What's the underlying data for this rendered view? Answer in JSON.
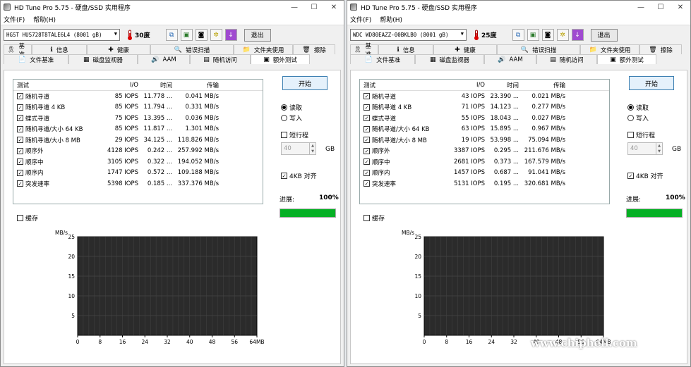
{
  "menu": {
    "file": "文件(F)",
    "help": "帮助(H)"
  },
  "window_buttons": {
    "minimize": "—",
    "maximize": "☐",
    "close": "✕"
  },
  "tabs_row1": [
    {
      "label": "基准",
      "icon": "ribbon-icon"
    },
    {
      "label": "信息",
      "icon": "info-icon"
    },
    {
      "label": "健康",
      "icon": "health-icon"
    },
    {
      "label": "错误扫描",
      "icon": "magnifier-icon"
    },
    {
      "label": "文件夹使用",
      "icon": "folder-icon"
    },
    {
      "label": "擦除",
      "icon": "trash-icon"
    }
  ],
  "tabs_row2": [
    {
      "label": "文件基准",
      "icon": "file-benchmark-icon"
    },
    {
      "label": "磁盘监视器",
      "icon": "disk-monitor-icon"
    },
    {
      "label": "AAM",
      "icon": "speaker-icon"
    },
    {
      "label": "随机访问",
      "icon": "random-access-icon"
    },
    {
      "label": "额外测试",
      "icon": "extra-tests-icon",
      "active": true
    }
  ],
  "table_headers": {
    "test": "测试",
    "io": "I/O",
    "time": "时间",
    "transfer": "传输"
  },
  "controls": {
    "start": "开始",
    "read": "读取",
    "write": "写入",
    "short_stroke": "短行程",
    "stroke_value": "40",
    "gb": "GB",
    "align_4kb": "4KB 对齐",
    "progress_label": "进展:",
    "cache": "缓存"
  },
  "chart_axes": {
    "y_unit": "MB/s",
    "y_ticks": [
      "25",
      "20",
      "15",
      "10",
      "5"
    ],
    "x_ticks": [
      "0",
      "8",
      "16",
      "24",
      "32",
      "40",
      "48",
      "56",
      "64MB"
    ]
  },
  "windows": [
    {
      "title": "HD Tune Pro 5.75 - 硬盘/SSD 实用程序",
      "drive": "HGST HUS728T8TALE6L4 (8001 gB)",
      "temperature": "30度",
      "exit": "退出",
      "progress": "100%",
      "progress_fraction": 1.0,
      "rows": [
        {
          "name": "随机寻道",
          "io": "85 IOPS",
          "time": "11.778 ...",
          "transfer": "0.041 MB/s"
        },
        {
          "name": "随机寻道 4 KB",
          "io": "85 IOPS",
          "time": "11.794 ...",
          "transfer": "0.331 MB/s"
        },
        {
          "name": "蝶式寻道",
          "io": "75 IOPS",
          "time": "13.395 ...",
          "transfer": "0.036 MB/s"
        },
        {
          "name": "随机寻道/大小 64 KB",
          "io": "85 IOPS",
          "time": "11.817 ...",
          "transfer": "1.301 MB/s"
        },
        {
          "name": "随机寻道/大小 8 MB",
          "io": "29 IOPS",
          "time": "34.125 ...",
          "transfer": "118.826 MB/s"
        },
        {
          "name": "顺序外",
          "io": "4128 IOPS",
          "time": "0.242 ...",
          "transfer": "257.992 MB/s"
        },
        {
          "name": "顺序中",
          "io": "3105 IOPS",
          "time": "0.322 ...",
          "transfer": "194.052 MB/s"
        },
        {
          "name": "顺序内",
          "io": "1747 IOPS",
          "time": "0.572 ...",
          "transfer": "109.188 MB/s"
        },
        {
          "name": "突发速率",
          "io": "5398 IOPS",
          "time": "0.185 ...",
          "transfer": "337.376 MB/s"
        }
      ]
    },
    {
      "title": "HD Tune Pro 5.75 - 硬盘/SSD 实用程序",
      "drive": "WDC WD80EAZZ-00BKLB0 (8001 gB)",
      "temperature": "25度",
      "exit": "退出",
      "progress": "100%",
      "progress_fraction": 1.0,
      "rows": [
        {
          "name": "随机寻道",
          "io": "43 IOPS",
          "time": "23.390 ...",
          "transfer": "0.021 MB/s"
        },
        {
          "name": "随机寻道 4 KB",
          "io": "71 IOPS",
          "time": "14.123 ...",
          "transfer": "0.277 MB/s"
        },
        {
          "name": "蝶式寻道",
          "io": "55 IOPS",
          "time": "18.043 ...",
          "transfer": "0.027 MB/s"
        },
        {
          "name": "随机寻道/大小 64 KB",
          "io": "63 IOPS",
          "time": "15.895 ...",
          "transfer": "0.967 MB/s"
        },
        {
          "name": "随机寻道/大小 8 MB",
          "io": "19 IOPS",
          "time": "53.998 ...",
          "transfer": "75.094 MB/s"
        },
        {
          "name": "顺序外",
          "io": "3387 IOPS",
          "time": "0.295 ...",
          "transfer": "211.676 MB/s"
        },
        {
          "name": "顺序中",
          "io": "2681 IOPS",
          "time": "0.373 ...",
          "transfer": "167.579 MB/s"
        },
        {
          "name": "顺序内",
          "io": "1457 IOPS",
          "time": "0.687 ...",
          "transfer": "91.041 MB/s"
        },
        {
          "name": "突发速率",
          "io": "5131 IOPS",
          "time": "0.195 ...",
          "transfer": "320.681 MB/s"
        }
      ]
    }
  ],
  "watermark": {
    "site": "www.chiphell.com"
  },
  "colors": {
    "progress_green": "#06b025",
    "chart_bg": "#2b2b2b",
    "start_border": "#3c7fb1"
  }
}
